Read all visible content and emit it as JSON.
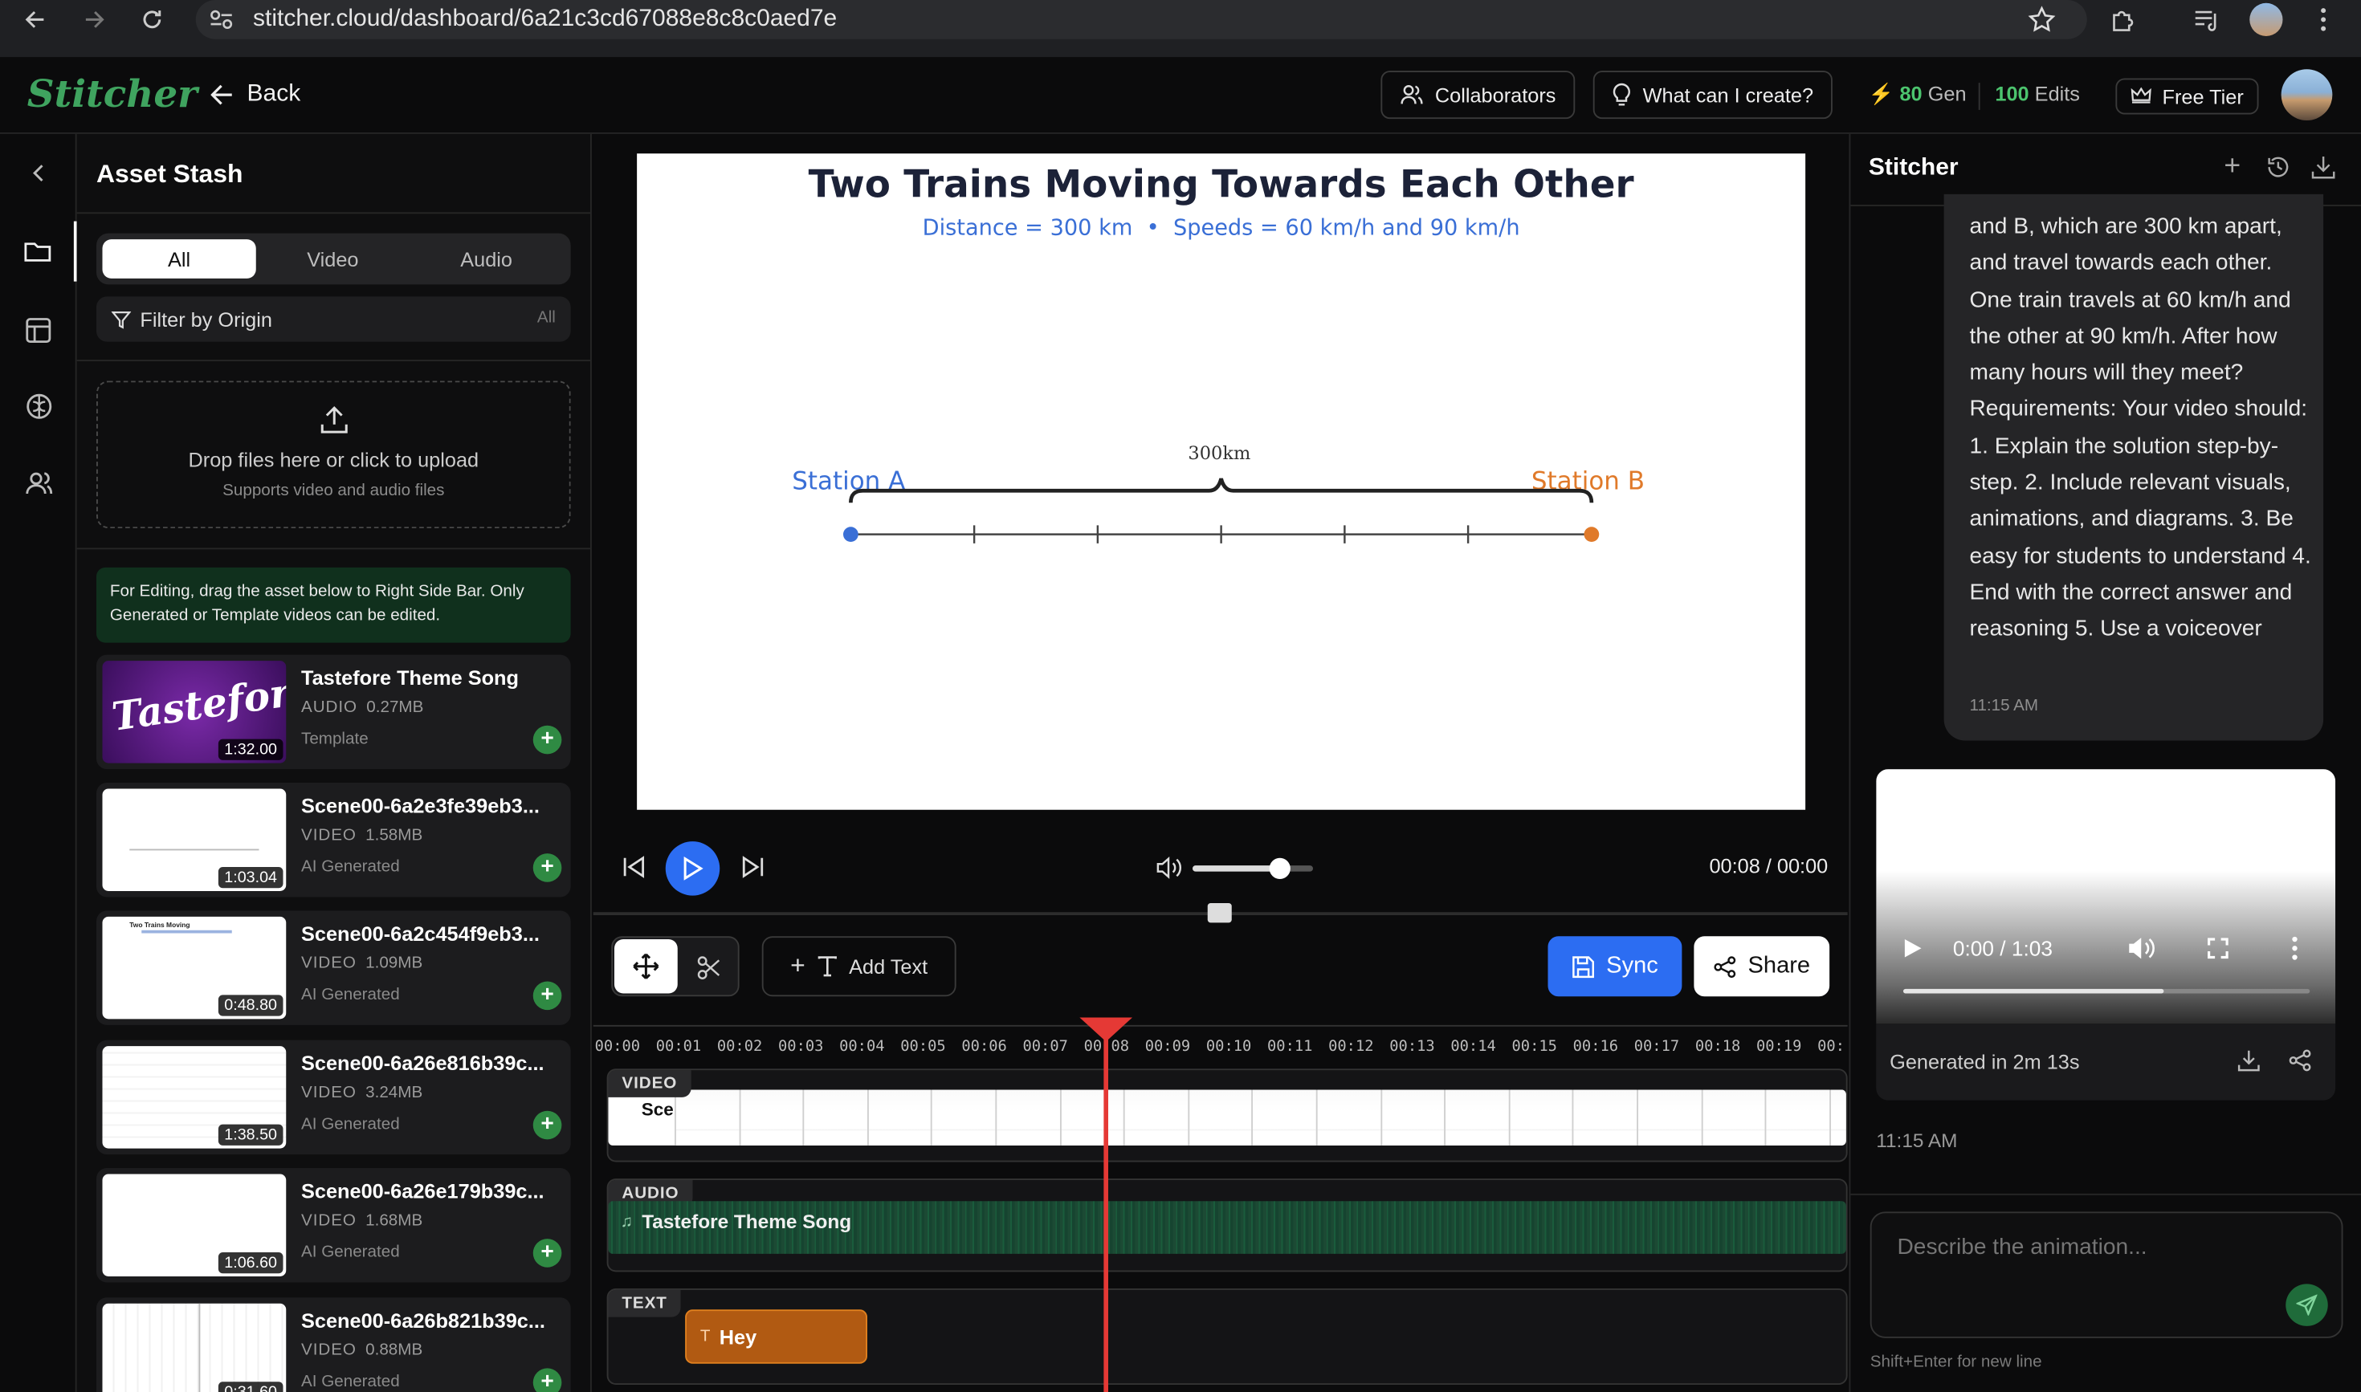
{
  "browser": {
    "url": "stitcher.cloud/dashboard/6a21c3cd67088e8c8c0aed7e"
  },
  "header": {
    "logo": "Stitcher",
    "back_label": "Back",
    "collaborators_label": "Collaborators",
    "what_can_label": "What can I create?",
    "gen_count": "80",
    "gen_label": "Gen",
    "edits_count": "100",
    "edits_label": "Edits",
    "tier_label": "Free Tier"
  },
  "assets": {
    "title": "Asset Stash",
    "tabs": [
      "All",
      "Video",
      "Audio"
    ],
    "filter_label": "Filter by Origin",
    "filter_value": "All",
    "upload_title": "Drop files here or click to upload",
    "upload_subtitle": "Supports video and audio files",
    "notice": "For Editing, drag the asset below to Right Side Bar. Only Generated or Template videos can be edited.",
    "items": [
      {
        "title": "Tastefore Theme Song",
        "type": "AUDIO",
        "size": "0.27MB",
        "origin": "Template",
        "duration": "1:32.00",
        "thumb_text": "Tastefore"
      },
      {
        "title": "Scene00-6a2e3fe39eb3...",
        "type": "VIDEO",
        "size": "1.58MB",
        "origin": "AI Generated",
        "duration": "1:03.04"
      },
      {
        "title": "Scene00-6a2c454f9eb3...",
        "type": "VIDEO",
        "size": "1.09MB",
        "origin": "AI Generated",
        "duration": "0:48.80",
        "thumb_text": "Two Trains Moving"
      },
      {
        "title": "Scene00-6a26e816b39c...",
        "type": "VIDEO",
        "size": "3.24MB",
        "origin": "AI Generated",
        "duration": "1:38.50"
      },
      {
        "title": "Scene00-6a26e179b39c...",
        "type": "VIDEO",
        "size": "1.68MB",
        "origin": "AI Generated",
        "duration": "1:06.60"
      },
      {
        "title": "Scene00-6a26b821b39c...",
        "type": "VIDEO",
        "size": "0.88MB",
        "origin": "AI Generated",
        "duration": "0:31.60"
      }
    ]
  },
  "canvas": {
    "title": "Two Trains Moving Towards Each Other",
    "subtitle": "Distance = 300 km  •  Speeds = 60 km/h and 90 km/h",
    "station_a": "Station A",
    "station_b": "Station B",
    "distance_label": "300km",
    "colors": {
      "station_a": "#3a6fd6",
      "station_b": "#e07a2a",
      "title": "#1c2238"
    }
  },
  "player": {
    "time": "00:08 / 00:00",
    "volume": 0.72
  },
  "toolbar": {
    "add_text_label": "Add Text",
    "sync_label": "Sync",
    "share_label": "Share"
  },
  "timeline": {
    "ticks": [
      "00:00",
      "00:01",
      "00:02",
      "00:03",
      "00:04",
      "00:05",
      "00:06",
      "00:07",
      "00:08",
      "00:09",
      "00:10",
      "00:11",
      "00:12",
      "00:13",
      "00:14",
      "00:15",
      "00:16",
      "00:17",
      "00:18",
      "00:19",
      "00:"
    ],
    "video_label": "VIDEO",
    "video_clip_label": "Sce",
    "audio_label": "AUDIO",
    "audio_clip_label": "Tastefore Theme Song",
    "text_label": "TEXT",
    "text_clip_label": "Hey",
    "playhead_time": "00:08"
  },
  "chat": {
    "title": "Stitcher",
    "message": "and B, which are 300 km apart, and travel towards each other. One train travels at 60 km/h and the other at 90 km/h. After how many hours will they meet? Requirements: Your video should: 1. Explain the solution step-by-step. 2. Include relevant visuals, animations, and diagrams. 3. Be easy for students to understand 4. End with the correct answer and reasoning 5. Use a voiceover",
    "message_time": "11:15 AM",
    "video_time": "0:00 / 1:03",
    "video_progress": 0.64,
    "generated_label": "Generated in 2m 13s",
    "reply_time": "11:15 AM",
    "input_placeholder": "Describe the animation...",
    "input_hint": "Shift+Enter for new line"
  }
}
